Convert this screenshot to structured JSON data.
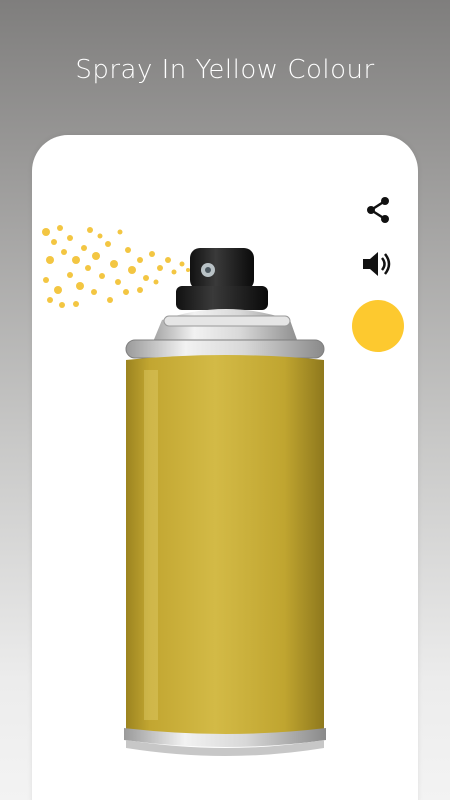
{
  "header": {
    "title": "Spray In Yellow Colour"
  },
  "toolbar": {
    "share_icon": "share-icon",
    "sound_icon": "volume-icon",
    "selected_color": "#fdc92f"
  },
  "can": {
    "body_color": "#c8ac2f",
    "spray_color": "#f3c642"
  }
}
